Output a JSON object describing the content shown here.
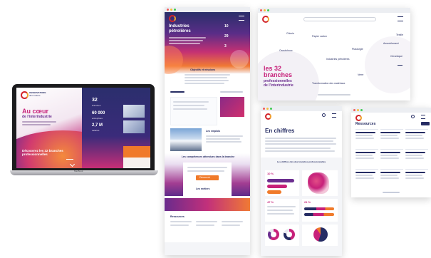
{
  "laptop": {
    "logo_line1": "OBSERVATOIRE",
    "logo_line2": "des métiers",
    "hero_title_line1": "Au cœur",
    "hero_title_line2": "de l'interindustrie",
    "cta_text": "Découvrez les 32 branches professionnelles",
    "stat1_value": "32",
    "stat1_label": "branches",
    "stat2_value": "60 000",
    "stat2_label": "entreprises",
    "stat3_value": "2,7 M",
    "stat3_label": "salariés",
    "brand": "MacBook"
  },
  "tall_page": {
    "hero_title_line1": "Industries",
    "hero_title_line2": "pétrolières",
    "stat1": "10",
    "stat2": "29",
    "stat3": "3",
    "section1_title": "Objectifs et missions",
    "section2_title": "Les emplois",
    "section3_title": "Les compétences attendues dans la branche",
    "section4_title": "Les métiers",
    "section5_title": "Ressources",
    "cta_orange": "Découvrir"
  },
  "branches_page": {
    "title_line1": "les 32",
    "title_line2": "branches",
    "title_line3": "professionnelles",
    "title_line4": "de l'interindustrie",
    "labels": [
      "Chimie",
      "Papier carton",
      "Textile",
      "Caoutchouc",
      "Industries pétrolières",
      "Plasturgie",
      "Ameublement",
      "Céramique",
      "Verre",
      "Transformation des matériaux"
    ]
  },
  "stats_page": {
    "title": "En chiffres",
    "subtitle": "Les chiffres clés des branches professionnelles",
    "kpi1": "10 %",
    "kpi2": "47 %",
    "kpi3": "21 %"
  },
  "resources_page": {
    "title": "Ressources"
  },
  "colors": {
    "accent_magenta": "#c7217a",
    "accent_orange": "#f07a2a",
    "navy": "#252c63",
    "purple": "#6b2d8f"
  }
}
